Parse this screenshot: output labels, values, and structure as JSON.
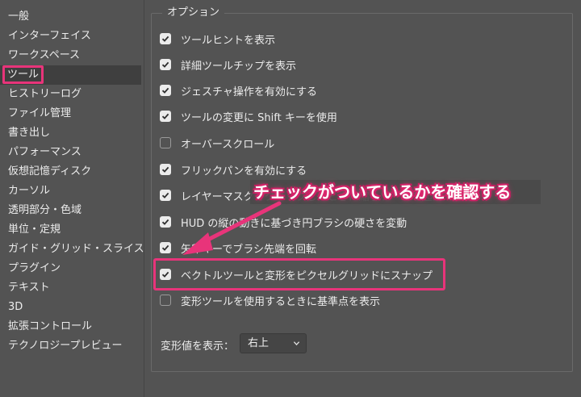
{
  "sidebar": {
    "items": [
      {
        "label": "一般"
      },
      {
        "label": "インターフェイス"
      },
      {
        "label": "ワークスペース"
      },
      {
        "label": "ツール"
      },
      {
        "label": "ヒストリーログ"
      },
      {
        "label": "ファイル管理"
      },
      {
        "label": "書き出し"
      },
      {
        "label": "パフォーマンス"
      },
      {
        "label": "仮想記憶ディスク"
      },
      {
        "label": "カーソル"
      },
      {
        "label": "透明部分・色域"
      },
      {
        "label": "単位・定規"
      },
      {
        "label": "ガイド・グリッド・スライス"
      },
      {
        "label": "プラグイン"
      },
      {
        "label": "テキスト"
      },
      {
        "label": "3D"
      },
      {
        "label": "拡張コントロール"
      },
      {
        "label": "テクノロジープレビュー"
      }
    ],
    "selected_index": 3
  },
  "options": {
    "group_title": "オプション",
    "items": [
      {
        "label": "ツールヒントを表示",
        "checked": true
      },
      {
        "label": "詳細ツールチップを表示",
        "checked": true
      },
      {
        "label": "ジェスチャ操作を有効にする",
        "checked": true
      },
      {
        "label": "ツールの変更に Shift キーを使用",
        "checked": true
      },
      {
        "label": "オーバースクロール",
        "checked": false
      },
      {
        "label": "フリックパンを有効にする",
        "checked": true
      },
      {
        "label": "レイヤーマスクでクリックしたときに縮小ツールを起動",
        "checked": true
      },
      {
        "label": "HUD の縦の動きに基づき円ブラシの硬さを変動",
        "checked": true
      },
      {
        "label": "矢印キーでブラシ先端を回転",
        "checked": true
      },
      {
        "label": "ベクトルツールと変形をピクセルグリッドにスナップ",
        "checked": true
      },
      {
        "label": "変形ツールを使用するときに基準点を表示",
        "checked": false
      }
    ]
  },
  "transform_values": {
    "label": "変形値を表示：",
    "selected": "右上"
  },
  "annotation": {
    "text": "チェックがついているかを確認する"
  },
  "colors": {
    "background": "#535353",
    "highlight": "#e8347a",
    "selected_row": "#3f3f3f"
  }
}
